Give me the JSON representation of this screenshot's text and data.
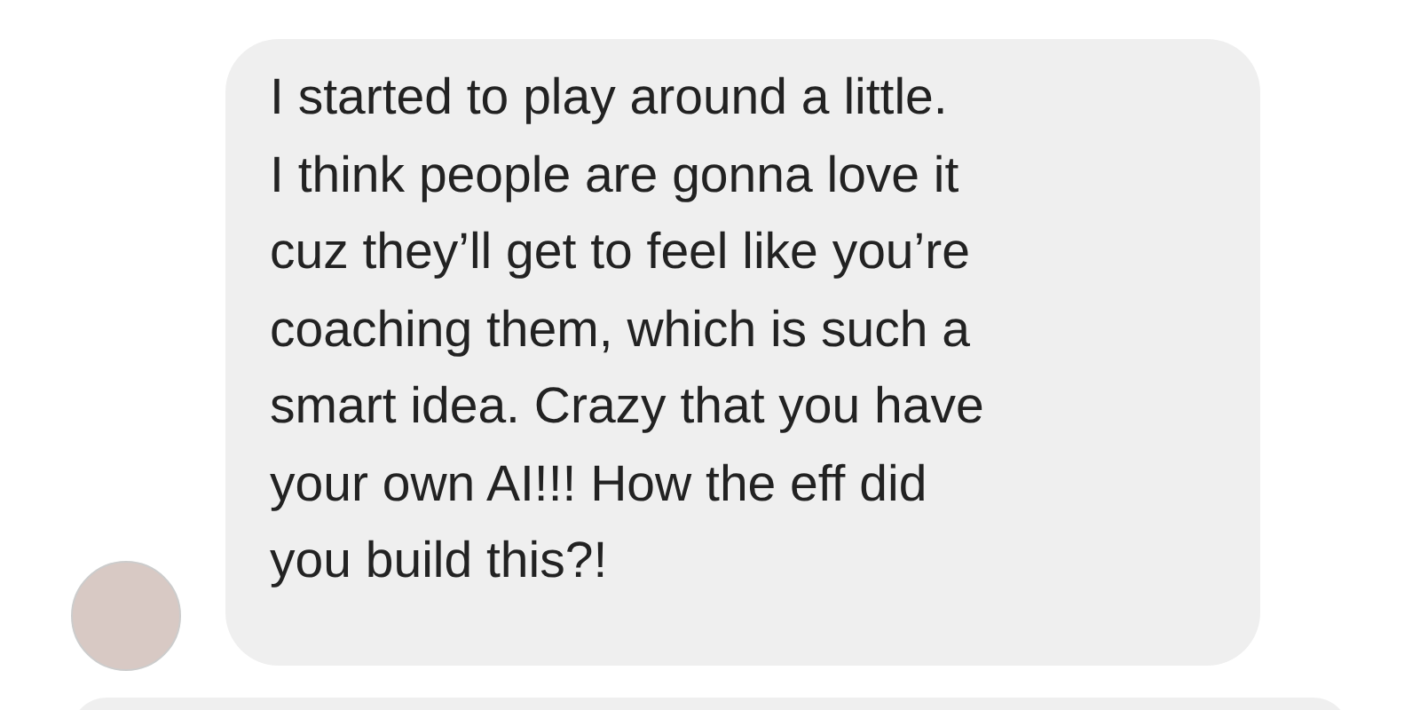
{
  "messages": [
    {
      "kind": "received",
      "lines": [
        "I started to play around a little.",
        "I think people are gonna love it",
        "cuz they’ll get to feel like you’re",
        "coaching them, which is such a",
        "smart idea. Crazy that you have",
        "your own AI!!! How the eff did",
        "you build this?!"
      ]
    },
    {
      "kind": "cut"
    }
  ]
}
